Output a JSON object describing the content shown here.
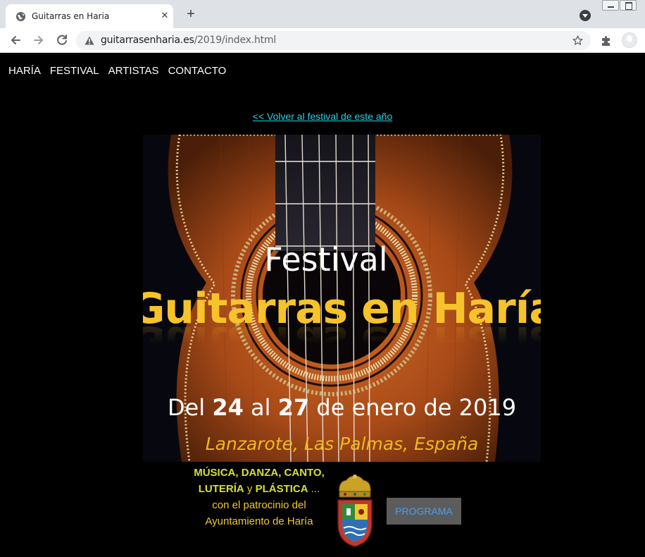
{
  "browser": {
    "tab_title": "Guitarras en Haria",
    "url_host": "guitarrasenharia.es",
    "url_path": "/2019/index.html",
    "icons": {
      "favicon": "globe-icon",
      "tab_close": "close-icon",
      "new_tab": "plus-icon",
      "tab_search": "chevron-down-icon",
      "back": "arrow-left-icon",
      "forward": "arrow-right-icon",
      "reload": "reload-icon",
      "security": "warning-icon",
      "bookmark": "star-icon",
      "extensions": "puzzle-icon",
      "profile": "avatar-icon"
    }
  },
  "nav": {
    "items": [
      "HARÍA",
      "FESTIVAL",
      "ARTISTAS",
      "CONTACTO"
    ]
  },
  "back_link": "<< Volver al festival de este año",
  "poster": {
    "festival": "Festival",
    "title": "Guitarras en Haría",
    "dates_prefix": "Del ",
    "date_start": "24",
    "dates_mid": " al ",
    "date_end": "27",
    "dates_suffix": " de enero de 2019",
    "place": "Lanzarote, Las Palmas, España"
  },
  "description": {
    "highlight_1": "MÚSICA, DANZA, CANTO, LUTERÍA",
    "connector": " y ",
    "highlight_2": "PLÁSTICA",
    "rest": " ... con el patrocinio del Ayuntamiento de Haría"
  },
  "programa_button": "PROGRAMA",
  "colors": {
    "page_bg": "#000000",
    "link": "#25d0e6",
    "title_gold": "#f6c32a",
    "desc_highlight": "#d7e02e",
    "button_bg": "#5c5c5c",
    "button_text": "#4aa0ea"
  }
}
